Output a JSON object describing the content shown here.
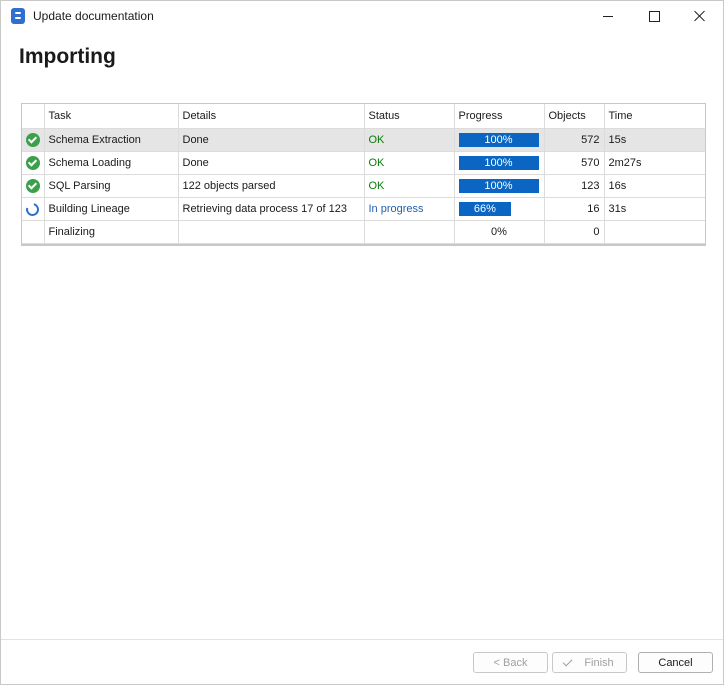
{
  "window": {
    "title": "Update documentation",
    "icon": "database-icon"
  },
  "page": {
    "heading": "Importing"
  },
  "grid": {
    "columns": [
      "",
      "Task",
      "Details",
      "Status",
      "Progress",
      "Objects",
      "Time"
    ],
    "rows": [
      {
        "icon": "check-circle-icon",
        "task": "Schema Extraction",
        "details": "Done",
        "status": "OK",
        "status_kind": "ok",
        "progress": 100,
        "progress_label": "100%",
        "objects": "572",
        "time": "15s",
        "selected": true
      },
      {
        "icon": "check-circle-icon",
        "task": "Schema Loading",
        "details": "Done",
        "status": "OK",
        "status_kind": "ok",
        "progress": 100,
        "progress_label": "100%",
        "objects": "570",
        "time": "2m27s",
        "selected": false
      },
      {
        "icon": "check-circle-icon",
        "task": "SQL Parsing",
        "details": "122 objects parsed",
        "status": "OK",
        "status_kind": "ok",
        "progress": 100,
        "progress_label": "100%",
        "objects": "123",
        "time": "16s",
        "selected": false
      },
      {
        "icon": "spinner-icon",
        "task": "Building Lineage",
        "details": "Retrieving data process 17 of 123",
        "status": "In progress",
        "status_kind": "progress",
        "progress": 66,
        "progress_label": "66%",
        "objects": "16",
        "time": "31s",
        "selected": false
      },
      {
        "icon": "",
        "task": "Finalizing",
        "details": "",
        "status": "",
        "status_kind": "",
        "progress": 0,
        "progress_label": "0%",
        "objects": "0",
        "time": "",
        "selected": false
      }
    ]
  },
  "buttons": {
    "back": "< Back",
    "finish": "Finish",
    "cancel": "Cancel"
  },
  "colors": {
    "progress_bar": "#0a66c2",
    "ok_text": "#0a7a0a",
    "in_progress_text": "#2060b0",
    "check_icon": "#3aa14a"
  }
}
